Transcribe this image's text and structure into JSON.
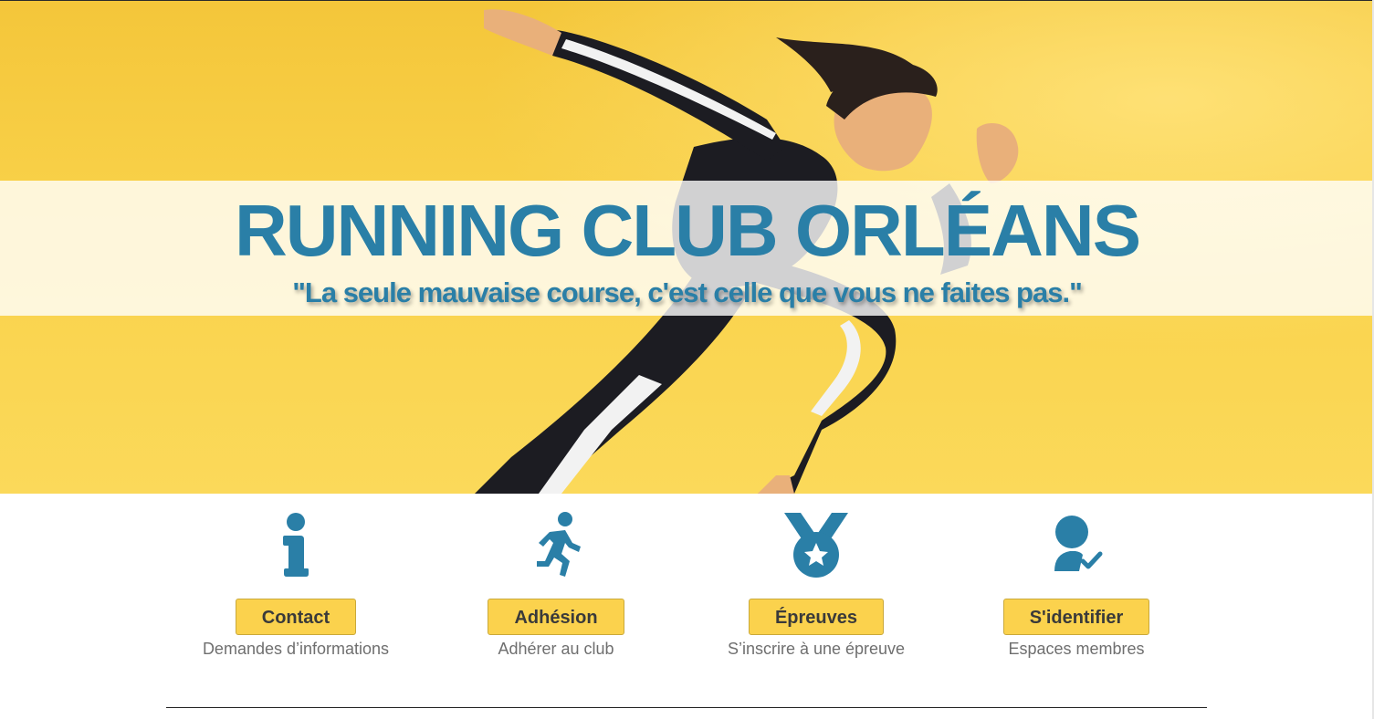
{
  "hero": {
    "title": "RUNNING CLUB ORLÉANS",
    "tagline": "\"La seule mauvaise course, c'est celle que vous ne faites pas.\""
  },
  "features": [
    {
      "icon": "info-icon",
      "button": "Contact",
      "subtitle": "Demandes d’informations"
    },
    {
      "icon": "running-person-icon",
      "button": "Adhésion",
      "subtitle": "Adhérer au club"
    },
    {
      "icon": "medal-icon",
      "button": "Épreuves",
      "subtitle": "S’inscrire à une épreuve"
    },
    {
      "icon": "user-check-icon",
      "button": "S'identifier",
      "subtitle": "Espaces membres"
    }
  ],
  "colors": {
    "brand_blue": "#2a7fa7",
    "button_yellow": "#fbd24d",
    "hero_yellow": "#f9d24a"
  }
}
